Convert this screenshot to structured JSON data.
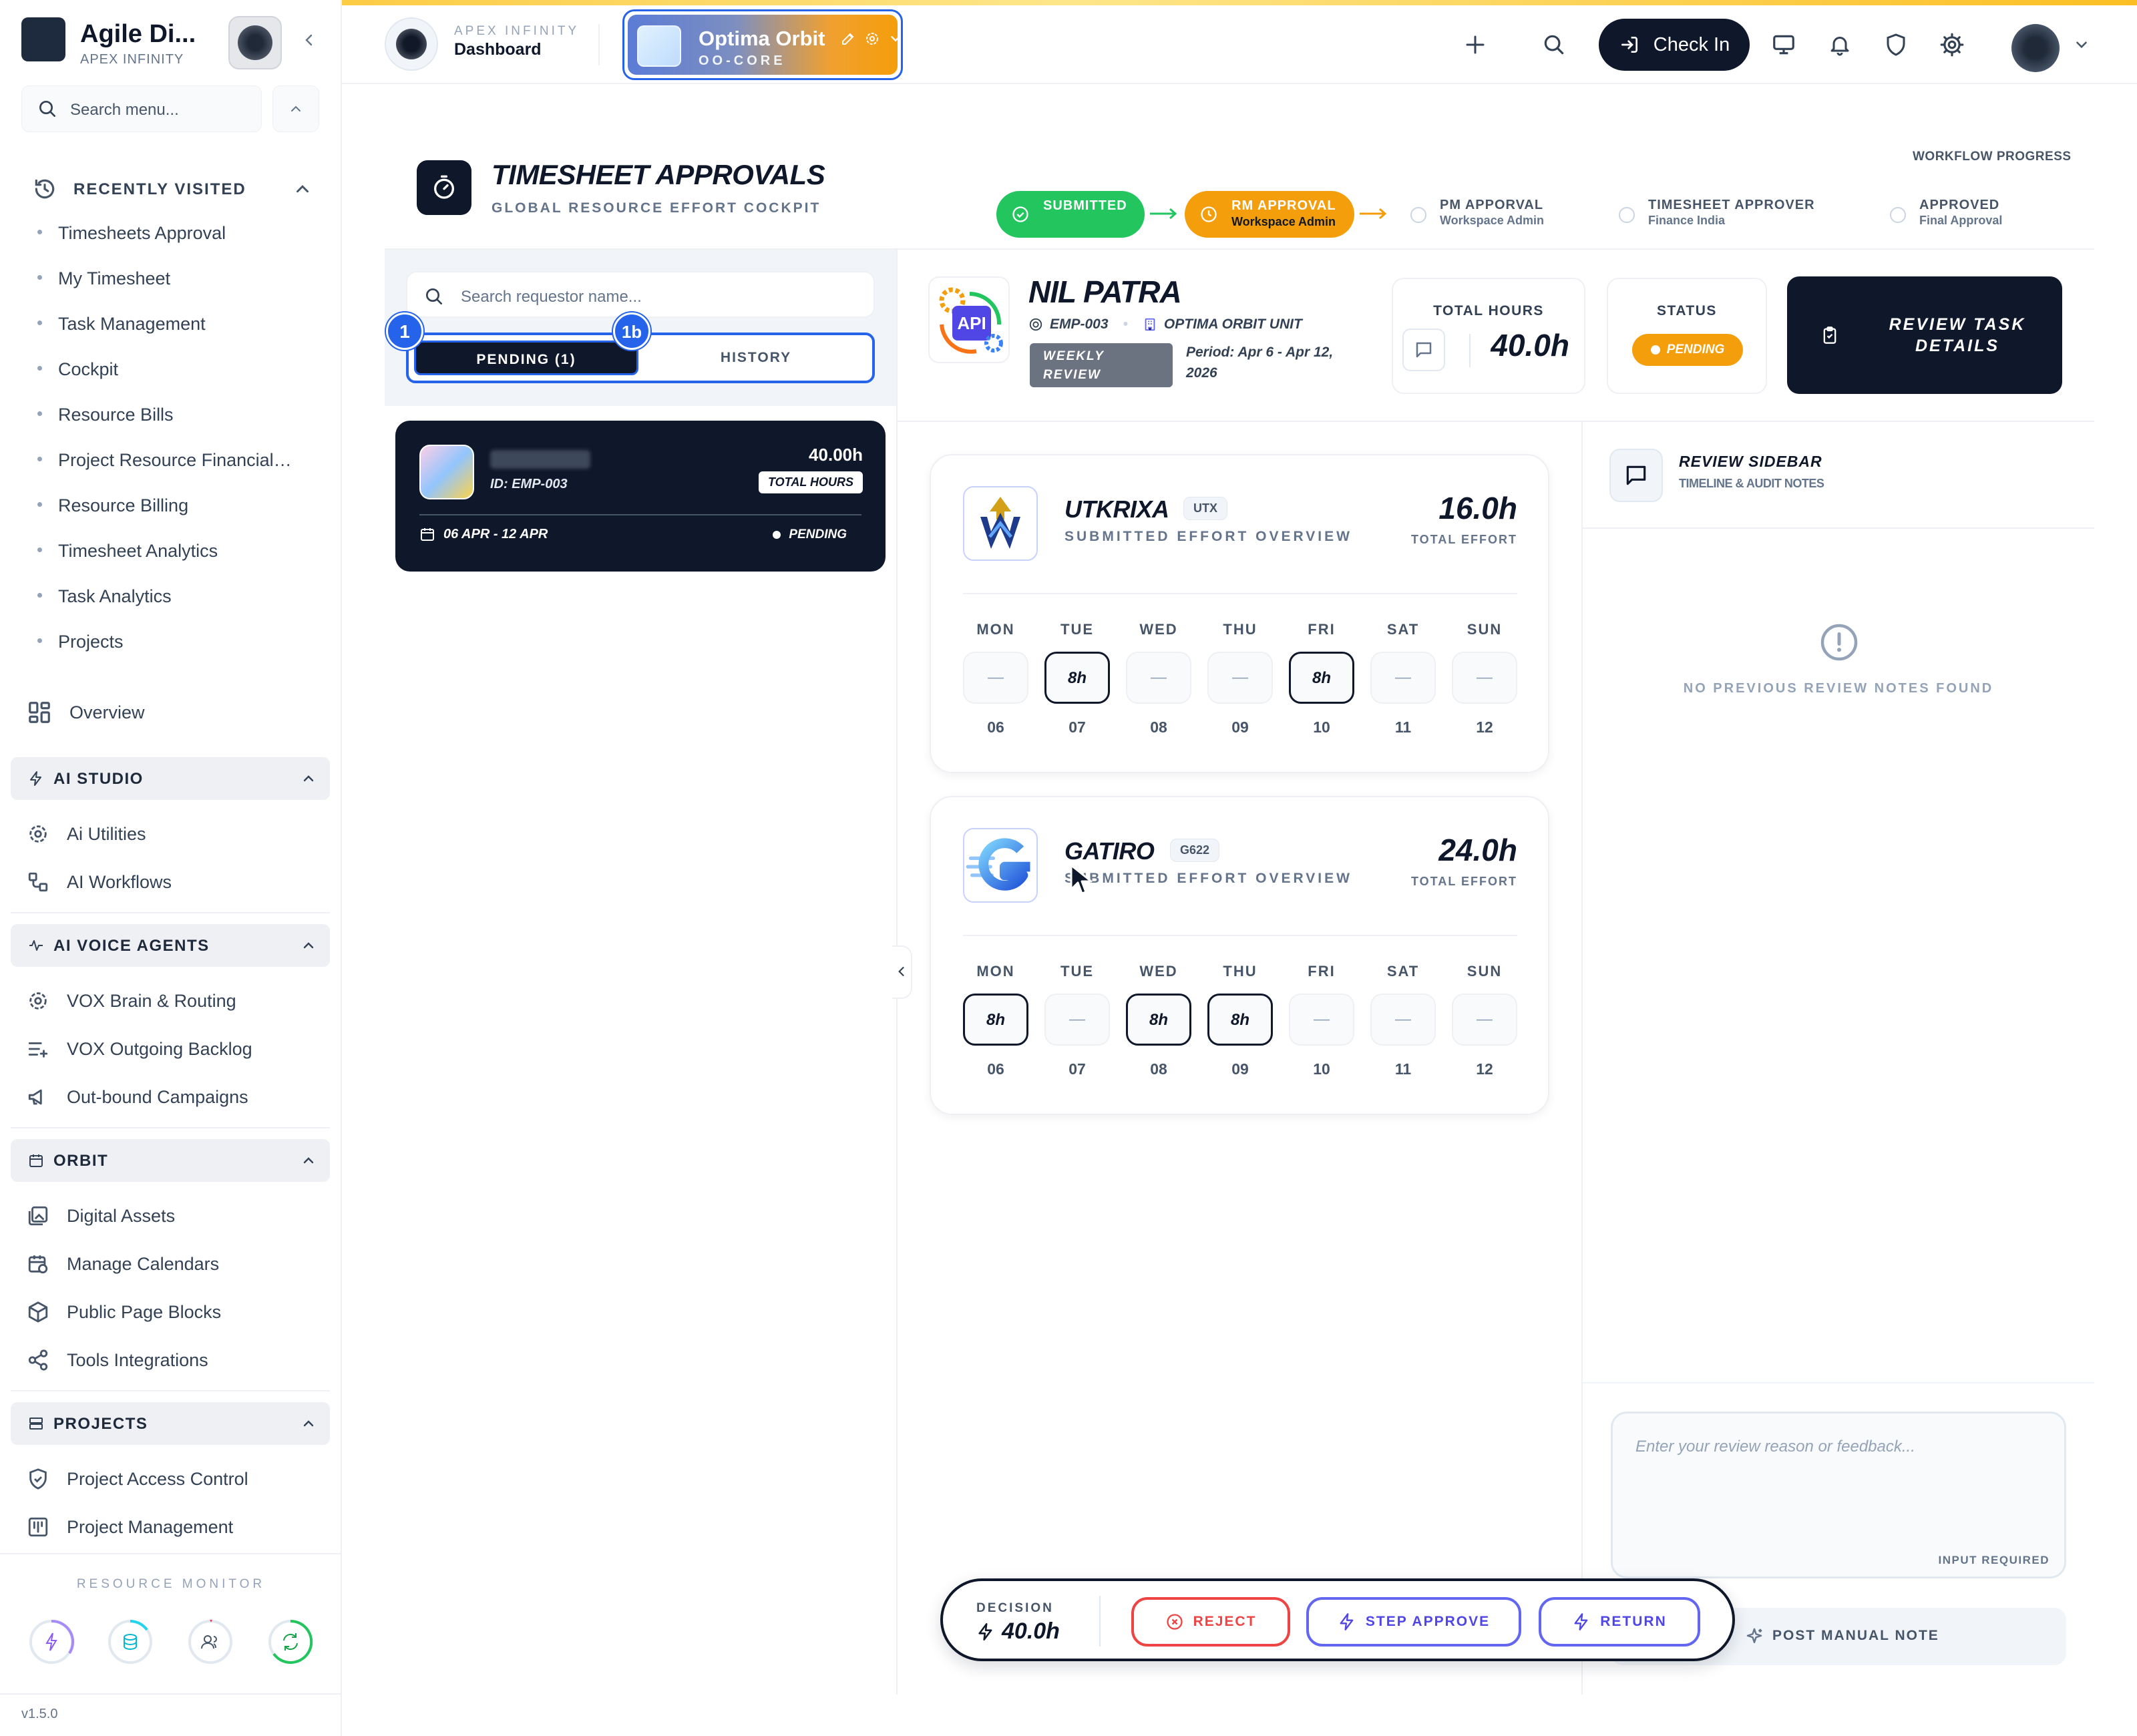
{
  "colors": {
    "dark": "#0f172a",
    "accent_blue": "#2563eb",
    "success": "#22c55e",
    "warning": "#f59e0b",
    "danger": "#ef4444",
    "indigo": "#6366f1"
  },
  "sidebar": {
    "brand_name": "Agile Di...",
    "brand_org": "APEX INFINITY",
    "search_placeholder": "Search menu...",
    "recently_visited_title": "RECENTLY VISITED",
    "recent_items": [
      "Timesheets Approval",
      "My Timesheet",
      "Task Management",
      "Cockpit",
      "Resource Bills",
      "Project Resource Financial…",
      "Resource Billing",
      "Timesheet Analytics",
      "Task Analytics",
      "Projects"
    ],
    "overview_label": "Overview",
    "sections": [
      {
        "title": "AI STUDIO",
        "items": [
          "Ai Utilities",
          "AI Workflows"
        ]
      },
      {
        "title": "AI VOICE AGENTS",
        "items": [
          "VOX Brain & Routing",
          "VOX Outgoing Backlog",
          "Out-bound Campaigns"
        ]
      },
      {
        "title": "ORBIT",
        "items": [
          "Digital Assets",
          "Manage Calendars",
          "Public Page Blocks",
          "Tools Integrations"
        ]
      },
      {
        "title": "PROJECTS",
        "items": [
          "Project Access Control",
          "Project Management"
        ]
      }
    ],
    "resource_monitor_label": "RESOURCE MONITOR",
    "version": "v1.5.0"
  },
  "header": {
    "org": "APEX INFINITY",
    "page": "Dashboard",
    "workspace_name": "Optima Orbit",
    "workspace_code": "OO-CORE",
    "checkin_label": "Check In"
  },
  "page": {
    "title": "TIMESHEET APPROVALS",
    "subtitle": "GLOBAL RESOURCE EFFORT COCKPIT"
  },
  "workflow": {
    "label": "WORKFLOW PROGRESS",
    "steps": [
      {
        "title": "SUBMITTED",
        "sub": "",
        "state": "done"
      },
      {
        "title": "RM APPROVAL",
        "sub": "Workspace Admin",
        "state": "current"
      },
      {
        "title": "PM APPORVAL",
        "sub": "Workspace Admin",
        "state": "pending"
      },
      {
        "title": "TIMESHEET APPROVER",
        "sub": "Finance India",
        "state": "pending"
      },
      {
        "title": "APPROVED",
        "sub": "Final Approval",
        "state": "pending"
      }
    ]
  },
  "requests": {
    "search_placeholder": "Search requestor name...",
    "tab_pending": "PENDING (1)",
    "tab_history": "HISTORY",
    "badge_1": "1",
    "badge_1b": "1b",
    "card": {
      "id": "ID: EMP-003",
      "hours": "40.00h",
      "hours_label": "TOTAL HOURS",
      "date_range": "06 APR - 12 APR",
      "status": "PENDING"
    }
  },
  "employee": {
    "name": "NIL PATRA",
    "emp_id": "EMP-003",
    "unit": "OPTIMA ORBIT UNIT",
    "review_type": "WEEKLY REVIEW",
    "period": "Period: Apr 6 - Apr 12, 2026",
    "logo_text": "API",
    "total_hours_label": "TOTAL HOURS",
    "total_hours": "40.0h",
    "status_label": "STATUS",
    "status": "PENDING",
    "review_button": "REVIEW TASK DETAILS"
  },
  "companies": [
    {
      "name": "UTKRIXA",
      "code": "UTX",
      "subtitle": "SUBMITTED EFFORT OVERVIEW",
      "total": "16.0h",
      "total_label": "TOTAL EFFORT",
      "days": [
        {
          "day": "MON",
          "date": "06",
          "value": "—",
          "filled": false
        },
        {
          "day": "TUE",
          "date": "07",
          "value": "8h",
          "filled": true
        },
        {
          "day": "WED",
          "date": "08",
          "value": "—",
          "filled": false
        },
        {
          "day": "THU",
          "date": "09",
          "value": "—",
          "filled": false
        },
        {
          "day": "FRI",
          "date": "10",
          "value": "8h",
          "filled": true
        },
        {
          "day": "SAT",
          "date": "11",
          "value": "—",
          "filled": false
        },
        {
          "day": "SUN",
          "date": "12",
          "value": "—",
          "filled": false
        }
      ]
    },
    {
      "name": "GATIRO",
      "code": "G622",
      "subtitle": "SUBMITTED EFFORT OVERVIEW",
      "total": "24.0h",
      "total_label": "TOTAL EFFORT",
      "days": [
        {
          "day": "MON",
          "date": "06",
          "value": "8h",
          "filled": true
        },
        {
          "day": "TUE",
          "date": "07",
          "value": "—",
          "filled": false
        },
        {
          "day": "WED",
          "date": "08",
          "value": "8h",
          "filled": true
        },
        {
          "day": "THU",
          "date": "09",
          "value": "8h",
          "filled": true
        },
        {
          "day": "FRI",
          "date": "10",
          "value": "—",
          "filled": false
        },
        {
          "day": "SAT",
          "date": "11",
          "value": "—",
          "filled": false
        },
        {
          "day": "SUN",
          "date": "12",
          "value": "—",
          "filled": false
        }
      ]
    }
  ],
  "review_sidebar": {
    "title": "REVIEW SIDEBAR",
    "subtitle": "TIMELINE & AUDIT NOTES",
    "empty_text": "NO PREVIOUS REVIEW NOTES FOUND",
    "feedback_placeholder": "Enter your review reason or feedback...",
    "input_required": "INPUT REQUIRED",
    "post_button": "POST MANUAL NOTE"
  },
  "decision": {
    "label": "DECISION",
    "value": "40.0h",
    "reject": "REJECT",
    "approve": "STEP APPROVE",
    "return": "RETURN"
  }
}
